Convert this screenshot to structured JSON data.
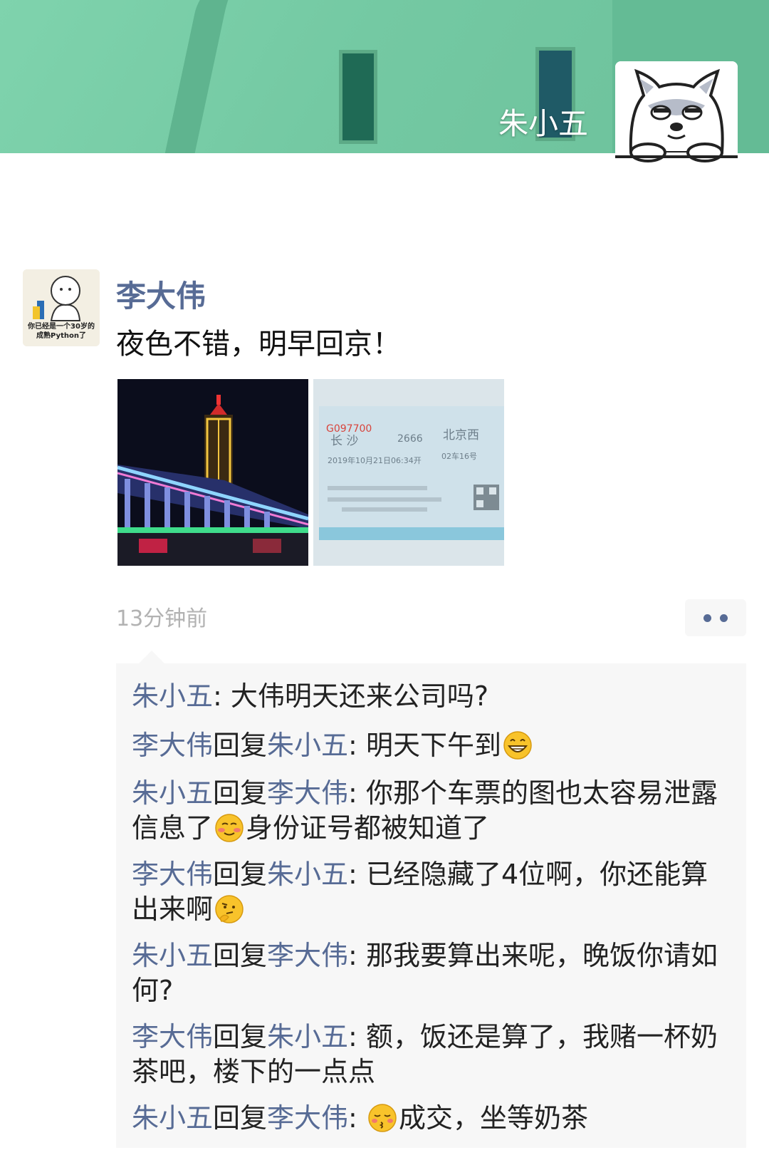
{
  "cover": {
    "owner_name": "朱小五"
  },
  "post": {
    "author": "李大伟",
    "avatar_caption_line1": "你已经是一个30岁的",
    "avatar_caption_line2": "成熟Python了",
    "text": "夜色不错，明早回京！",
    "time": "13分钟前",
    "ticket": {
      "number": "G097700",
      "from": "长 沙",
      "to": "北京西",
      "train": "2666",
      "date": "2019年10月21日06:34开",
      "seat": "02车16号"
    }
  },
  "comments": [
    {
      "from": "朱小五",
      "reply_word": "",
      "to": "",
      "text_before": "大伟明天还来公司吗?",
      "emoji": "",
      "text_after": ""
    },
    {
      "from": "李大伟",
      "reply_word": "回复",
      "to": "朱小五",
      "text_before": "明天下午到",
      "emoji": "grin-emoji",
      "text_after": ""
    },
    {
      "from": "朱小五",
      "reply_word": "回复",
      "to": "李大伟",
      "text_before": "你那个车票的图也太容易泄露信息了",
      "emoji": "smirk-emoji",
      "text_after": "身份证号都被知道了"
    },
    {
      "from": "李大伟",
      "reply_word": "回复",
      "to": "朱小五",
      "text_before": "已经隐藏了4位啊，你还能算出来啊",
      "emoji": "thinking-emoji",
      "text_after": ""
    },
    {
      "from": "朱小五",
      "reply_word": "回复",
      "to": "李大伟",
      "text_before": "那我要算出来呢，晚饭你请如何?",
      "emoji": "",
      "text_after": ""
    },
    {
      "from": "李大伟",
      "reply_word": "回复",
      "to": "朱小五",
      "text_before": "额，饭还是算了，我赌一杯奶茶吧，楼下的一点点",
      "emoji": "",
      "text_after": ""
    },
    {
      "from": "朱小五",
      "reply_word": "回复",
      "to": "李大伟",
      "text_before": "",
      "emoji": "kiss-emoji",
      "text_after": "成交，坐等奶茶"
    }
  ],
  "colors": {
    "link": "#576b95",
    "comment_bg": "#f7f7f7",
    "time": "#b2b2b2"
  }
}
